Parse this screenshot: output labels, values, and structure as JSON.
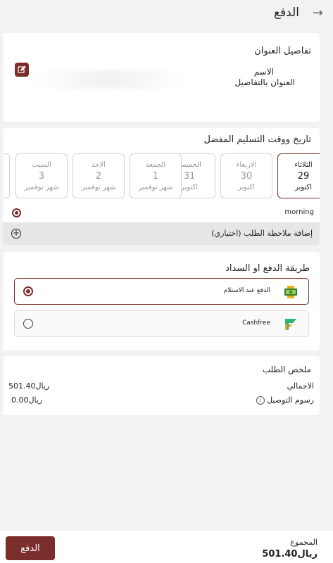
{
  "header": {
    "title": "الدفع",
    "back_icon": "arrow-right-icon"
  },
  "address": {
    "title": "تفاصيل العنوان",
    "name": "الاسم",
    "detail": "العنوان بالتفاصيل"
  },
  "delivery": {
    "title": "تاريخ ووقت التسليم المفضل",
    "days": [
      {
        "name": "الثلاثاء",
        "num": "29",
        "month": "اكتوبر",
        "selected": true
      },
      {
        "name": "الاربعاء",
        "num": "30",
        "month": "اكتوبر"
      },
      {
        "name": "الخميس",
        "num": "31",
        "month": "اكتوبر"
      },
      {
        "name": "الجمعة",
        "num": "1",
        "month": "شهر نوفمبر"
      },
      {
        "name": "الاحد",
        "num": "2",
        "month": "شهر نوفمبر"
      },
      {
        "name": "السبت",
        "num": "3",
        "month": "شهر نوفمبر"
      }
    ],
    "time_slot": "morning",
    "add_note": "إضافة ملاحظة الطلب (اختياري)"
  },
  "payment": {
    "title": "طريقة الدفع او السداد",
    "options": [
      {
        "label": "الدفع عند الاستلام",
        "icon": "cash-icon",
        "selected": true
      },
      {
        "label": "Cashfree",
        "icon": "cashfree-logo-icon",
        "selected": false
      }
    ]
  },
  "summary": {
    "title": "ملخص الطلب",
    "total_label": "الاجمالي",
    "total_value": "501.40ريال",
    "delivery_label": "رسوم التوصيل",
    "delivery_value": "0.00ريال"
  },
  "footer": {
    "pay_label": "الدفع",
    "sum_label": "المجموع",
    "sum_value": "501.40ريال"
  },
  "colors": {
    "accent": "#7a2e2b",
    "background": "#f2f2f2"
  }
}
